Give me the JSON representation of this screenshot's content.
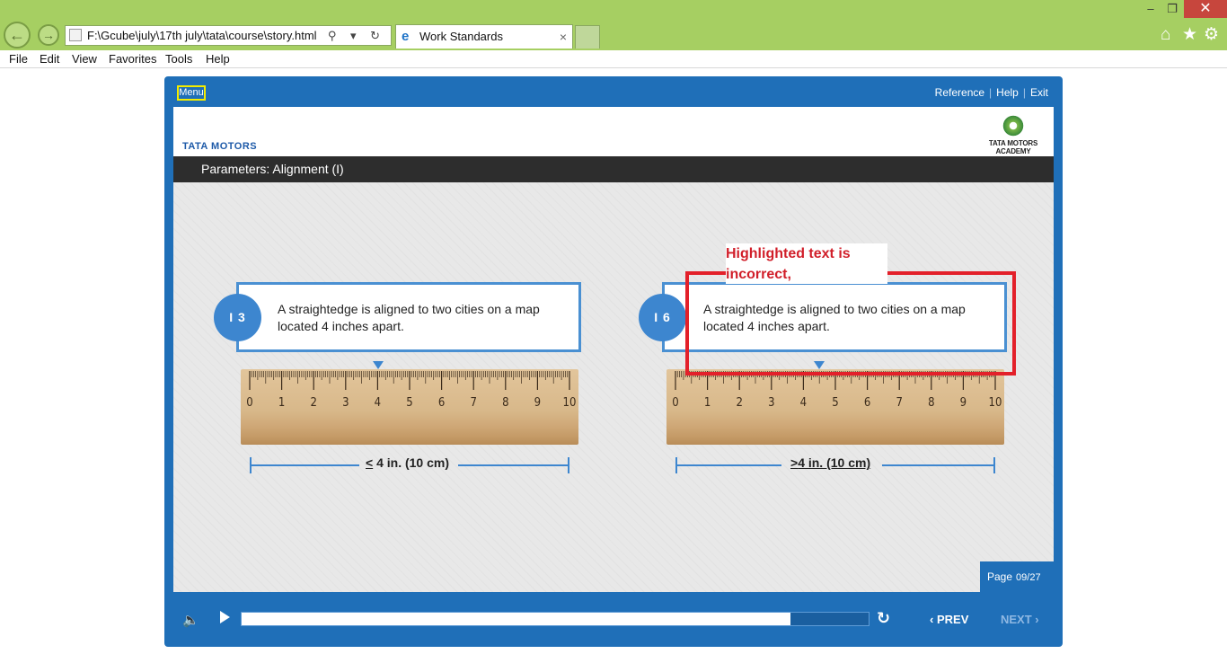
{
  "browser": {
    "address": "F:\\Gcube\\july\\17th july\\tata\\course\\story.html",
    "tab_title": "Work Standards",
    "tab_close": "×",
    "address_icons": "⚲ ▾ ↻",
    "win_min": "–",
    "win_max": "❐",
    "win_close": "✕",
    "home_icon": "⌂",
    "star_icon": "★",
    "gear_icon": "⚙",
    "back_glyph": "←",
    "fwd_glyph": "→",
    "ie_glyph": "e"
  },
  "menubar": [
    "File",
    "Edit",
    "View",
    "Favorites",
    "Tools",
    "Help"
  ],
  "player": {
    "menu_label": "Menu",
    "links": [
      "Reference",
      "Help",
      "Exit"
    ],
    "brand": "TATA MOTORS",
    "academy": "TATA MOTORS ACADEMY",
    "slide_title": "Parameters: Alignment (I)",
    "page_label": "Page",
    "page_number": "09/27",
    "prev_label": "PREV",
    "next_label": "NEXT",
    "progress_fraction": 0.876,
    "vol_glyph": "🔈",
    "replay_glyph": "↻",
    "prev_glyph": "‹",
    "next_glyph": "›"
  },
  "panels": [
    {
      "badge": "I 3",
      "text": "A straightedge is aligned to two cities on a map located 4 inches apart.",
      "ruler_numbers": [
        "0",
        "1",
        "2",
        "3",
        "4",
        "5",
        "6",
        "7",
        "8",
        "9",
        "10"
      ],
      "measure_symbol": "<",
      "measure_text": " 4 in. (10 cm)"
    },
    {
      "badge": "I 6",
      "text": "A straightedge is aligned to two cities on a map located 4 inches apart.",
      "ruler_numbers": [
        "0",
        "1",
        "2",
        "3",
        "4",
        "5",
        "6",
        "7",
        "8",
        "9",
        "10"
      ],
      "measure_symbol": ">",
      "measure_text": "4 in. (10 cm)"
    }
  ],
  "annotation": {
    "line1": "Highlighted text is",
    "line2": "incorrect,"
  },
  "colors": {
    "player_blue": "#1f6fb8",
    "badge_blue": "#3d86cf",
    "highlight_red": "#e3202a",
    "chrome_green": "#a6cf62"
  }
}
